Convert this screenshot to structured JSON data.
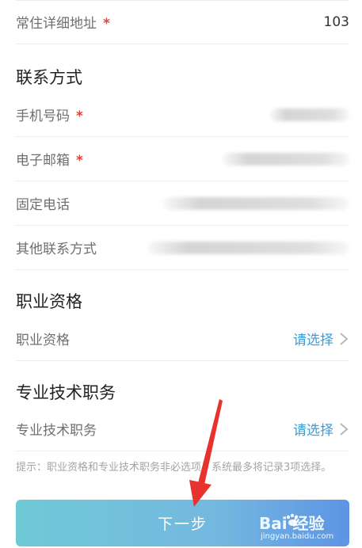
{
  "address": {
    "label": "常住详细地址",
    "required_mark": "*",
    "value": "103"
  },
  "contact_section": {
    "title": "联系方式",
    "fields": [
      {
        "label": "手机号码",
        "required_mark": "*"
      },
      {
        "label": "电子邮箱",
        "required_mark": "*"
      },
      {
        "label": "固定电话"
      },
      {
        "label": "其他联系方式"
      }
    ]
  },
  "qualification_section": {
    "title": "职业资格",
    "field_label": "职业资格",
    "select_text": "请选择"
  },
  "technical_section": {
    "title": "专业技术职务",
    "field_label": "专业技术职务",
    "select_text": "请选择"
  },
  "hint": "提示：职业资格和专业技术职务非必选项，系统最多将记录3项选择。",
  "next_button": "下一步",
  "watermark": {
    "main": "Bai 经验",
    "sub": "jingyan.baidu.com"
  },
  "colors": {
    "accent": "#3d9bd6",
    "required": "#e0453a",
    "annotation_arrow": "#e8322e"
  },
  "icons": [
    "chevron-right-icon",
    "red-arrow-annotation",
    "baidu-paw-icon"
  ]
}
